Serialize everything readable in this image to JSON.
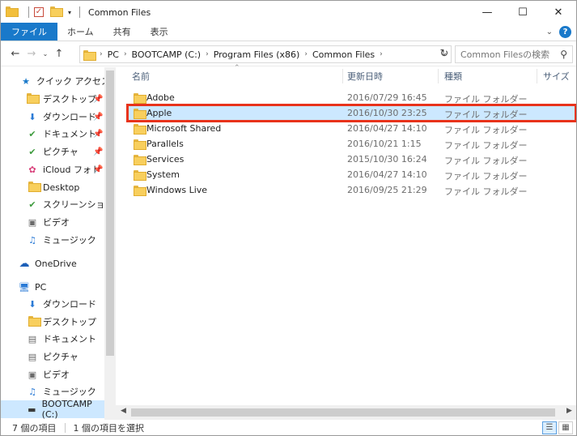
{
  "window": {
    "title": "Common Files"
  },
  "ribbon": {
    "tabs": [
      "ファイル",
      "ホーム",
      "共有",
      "表示"
    ]
  },
  "address": {
    "crumbs": [
      "PC",
      "BOOTCAMP (C:)",
      "Program Files (x86)",
      "Common Files"
    ],
    "search_placeholder": "Common Filesの検索"
  },
  "nav": {
    "quick_access": "クイック アクセス",
    "quick_items": [
      "デスクトップ",
      "ダウンロード",
      "ドキュメント",
      "ピクチャ",
      "iCloud フォト",
      "Desktop",
      "スクリーンショット",
      "ビデオ",
      "ミュージック"
    ],
    "onedrive": "OneDrive",
    "pc": "PC",
    "pc_items": [
      "ダウンロード",
      "デスクトップ",
      "ドキュメント",
      "ピクチャ",
      "ビデオ",
      "ミュージック",
      "BOOTCAMP (C:)"
    ]
  },
  "columns": {
    "name": "名前",
    "date": "更新日時",
    "type": "種類",
    "size": "サイズ"
  },
  "files": [
    {
      "name": "Adobe",
      "date": "2016/07/29 16:45",
      "type": "ファイル フォルダー"
    },
    {
      "name": "Apple",
      "date": "2016/10/30 23:25",
      "type": "ファイル フォルダー"
    },
    {
      "name": "Microsoft Shared",
      "date": "2016/04/27 14:10",
      "type": "ファイル フォルダー"
    },
    {
      "name": "Parallels",
      "date": "2016/10/21 1:15",
      "type": "ファイル フォルダー"
    },
    {
      "name": "Services",
      "date": "2015/10/30 16:24",
      "type": "ファイル フォルダー"
    },
    {
      "name": "System",
      "date": "2016/04/27 14:10",
      "type": "ファイル フォルダー"
    },
    {
      "name": "Windows Live",
      "date": "2016/09/25 21:29",
      "type": "ファイル フォルダー"
    }
  ],
  "status": {
    "count": "7 個の項目",
    "selected": "1 個の項目を選択"
  },
  "colors": {
    "accent": "#1979ca",
    "selection": "#cce8ff",
    "highlight_border": "#e8331b",
    "folder": "#f8cf5d"
  },
  "icons": [
    "folder-icon",
    "check-icon",
    "minimize-icon",
    "maximize-icon",
    "close-icon",
    "help-icon",
    "back-icon",
    "forward-icon",
    "up-icon",
    "refresh-icon",
    "search-icon",
    "star-icon",
    "pin-icon",
    "onedrive-icon",
    "pc-icon",
    "drive-icon"
  ]
}
